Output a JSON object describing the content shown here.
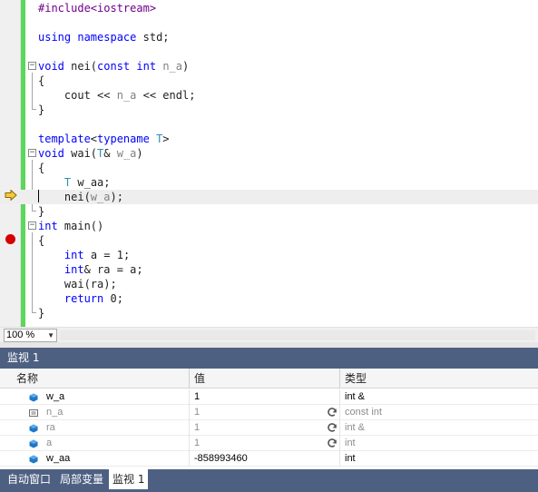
{
  "editor": {
    "lines": [
      [
        {
          "t": "#include<iostream>",
          "c": "pp"
        }
      ],
      [],
      [
        {
          "t": "using",
          "c": "kw"
        },
        {
          "t": " ",
          "c": "plain"
        },
        {
          "t": "namespace",
          "c": "kw"
        },
        {
          "t": " std;",
          "c": "plain"
        }
      ],
      [],
      [
        {
          "t": "void",
          "c": "kw"
        },
        {
          "t": " nei(",
          "c": "plain"
        },
        {
          "t": "const",
          "c": "kw"
        },
        {
          "t": " ",
          "c": "plain"
        },
        {
          "t": "int",
          "c": "kw"
        },
        {
          "t": " ",
          "c": "plain"
        },
        {
          "t": "n_a",
          "c": "par"
        },
        {
          "t": ")",
          "c": "plain"
        }
      ],
      [
        {
          "t": "{",
          "c": "plain"
        }
      ],
      [
        {
          "t": "    cout << ",
          "c": "plain"
        },
        {
          "t": "n_a",
          "c": "par"
        },
        {
          "t": " << endl;",
          "c": "plain"
        }
      ],
      [
        {
          "t": "}",
          "c": "plain"
        }
      ],
      [],
      [
        {
          "t": "template",
          "c": "kw"
        },
        {
          "t": "<",
          "c": "plain"
        },
        {
          "t": "typename",
          "c": "kw"
        },
        {
          "t": " ",
          "c": "plain"
        },
        {
          "t": "T",
          "c": "ty"
        },
        {
          "t": ">",
          "c": "plain"
        }
      ],
      [
        {
          "t": "void",
          "c": "kw"
        },
        {
          "t": " wai(",
          "c": "plain"
        },
        {
          "t": "T",
          "c": "ty"
        },
        {
          "t": "& ",
          "c": "plain"
        },
        {
          "t": "w_a",
          "c": "par"
        },
        {
          "t": ")",
          "c": "plain"
        }
      ],
      [
        {
          "t": "{",
          "c": "plain"
        }
      ],
      [
        {
          "t": "    ",
          "c": "plain"
        },
        {
          "t": "T",
          "c": "ty"
        },
        {
          "t": " w_aa;",
          "c": "plain"
        }
      ],
      [
        {
          "t": "    nei(",
          "c": "plain"
        },
        {
          "t": "w_a",
          "c": "par"
        },
        {
          "t": ");",
          "c": "plain"
        }
      ],
      [
        {
          "t": "}",
          "c": "plain"
        }
      ],
      [
        {
          "t": "int",
          "c": "kw"
        },
        {
          "t": " main()",
          "c": "plain"
        }
      ],
      [
        {
          "t": "{",
          "c": "plain"
        }
      ],
      [
        {
          "t": "    ",
          "c": "plain"
        },
        {
          "t": "int",
          "c": "kw"
        },
        {
          "t": " a = 1;",
          "c": "plain"
        }
      ],
      [
        {
          "t": "    ",
          "c": "plain"
        },
        {
          "t": "int",
          "c": "kw"
        },
        {
          "t": "& ra = a;",
          "c": "plain"
        }
      ],
      [
        {
          "t": "    wai(ra);",
          "c": "plain"
        }
      ],
      [
        {
          "t": "    ",
          "c": "plain"
        },
        {
          "t": "return",
          "c": "kw"
        },
        {
          "t": " 0;",
          "c": "plain"
        }
      ],
      [
        {
          "t": "}",
          "c": "plain"
        }
      ]
    ]
  },
  "zoom": {
    "value": "100 %"
  },
  "watch": {
    "title": "监视 1",
    "headers": {
      "name": "名称",
      "value": "值",
      "type": "类型"
    },
    "rows": [
      {
        "name": "w_a",
        "value": "1",
        "type": "int &",
        "icon": "variable-icon",
        "stale": false
      },
      {
        "name": "n_a",
        "value": "1",
        "type": "const int",
        "icon": "constant-icon",
        "stale": true
      },
      {
        "name": "ra",
        "value": "1",
        "type": "int &",
        "icon": "variable-icon",
        "stale": true
      },
      {
        "name": "a",
        "value": "1",
        "type": "int",
        "icon": "variable-icon",
        "stale": true
      },
      {
        "name": "w_aa",
        "value": "-858993460",
        "type": "int",
        "icon": "variable-icon",
        "stale": false
      }
    ]
  },
  "tabs": {
    "auto": "自动窗口",
    "locals": "局部变量",
    "watch1": "监视 1"
  },
  "colors": {
    "toolwindow_title": "#4d6082",
    "breakpoint": "#d40000",
    "change_bar": "#5cd65c",
    "keyword": "#0000ff",
    "type": "#2b91af",
    "parameter": "#808080",
    "preprocessor": "#6f008a"
  }
}
